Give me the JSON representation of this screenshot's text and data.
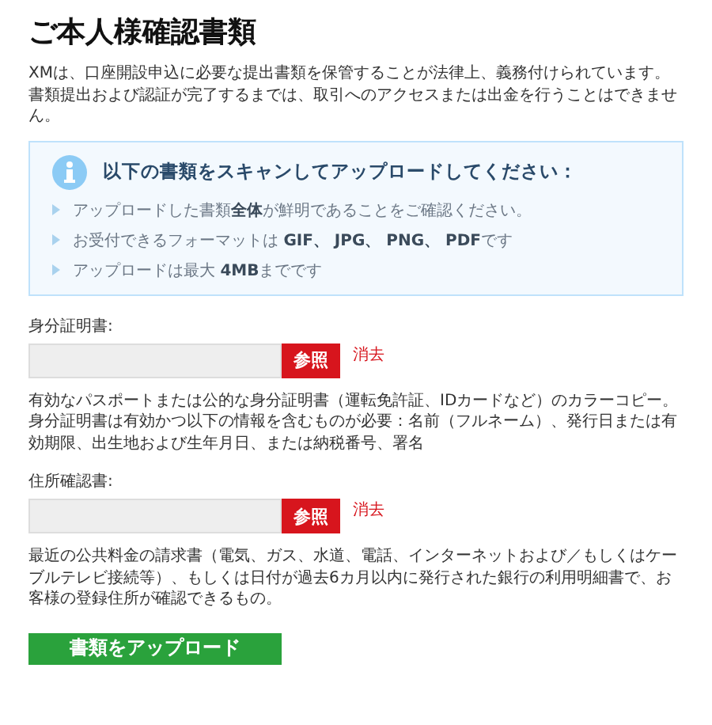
{
  "title": "ご本人様確認書類",
  "intro": "XMは、口座開設申込に必要な提出書類を保管することが法律上、義務付けられています。書類提出および認証が完了するまでは、取引へのアクセスまたは出金を行うことはできません。",
  "notice": {
    "heading": "以下の書類をスキャンしてアップロードしてください：",
    "items": [
      "アップロードした書類**全体**が鮮明であることをご確認ください。",
      "お受付できるフォーマットは **GIF、 JPG、 PNG、 PDF**です",
      "アップロードは最大 **4MB**までです"
    ]
  },
  "uploads": [
    {
      "label": "身分証明書:",
      "browse": "参照",
      "clear": "消去",
      "description": "有効なパスポートまたは公的な身分証明書（運転免許証、IDカードなど）のカラーコピー。身分証明書は有効かつ以下の情報を含むものが必要：名前（フルネーム）、発行日または有効期限、出生地および生年月日、または納税番号、署名"
    },
    {
      "label": "住所確認書:",
      "browse": "参照",
      "clear": "消去",
      "description": "最近の公共料金の請求書（電気、ガス、水道、電話、インターネットおよび／もしくはケーブルテレビ接続等）、もしくは日付が過去6カ月以内に発行された銀行の利用明細書で、お客様の登録住所が確認できるもの。"
    }
  ],
  "submit": "書類をアップロード"
}
